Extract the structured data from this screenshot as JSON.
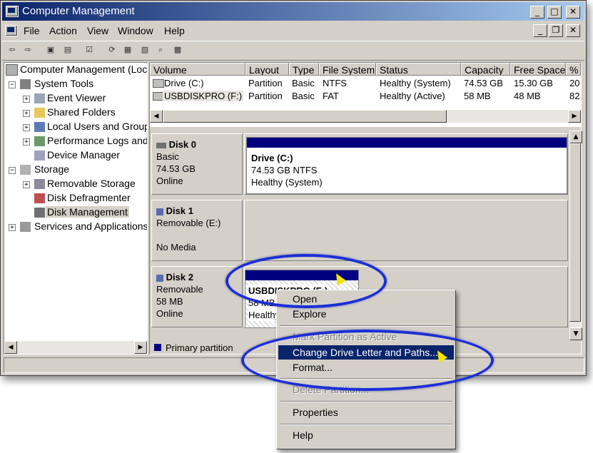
{
  "window": {
    "title": "Computer Management"
  },
  "menu": [
    "File",
    "Action",
    "View",
    "Window",
    "Help"
  ],
  "tree": {
    "root": "Computer Management (Loc",
    "system_tools": "System Tools",
    "event_viewer": "Event Viewer",
    "shared_folders": "Shared Folders",
    "local_users": "Local Users and Group",
    "perf_logs": "Performance Logs and",
    "device_manager": "Device Manager",
    "storage": "Storage",
    "removable_storage": "Removable Storage",
    "disk_defrag": "Disk Defragmenter",
    "disk_management": "Disk Management",
    "services": "Services and Applications"
  },
  "volume_list": {
    "columns": [
      "Volume",
      "Layout",
      "Type",
      "File System",
      "Status",
      "Capacity",
      "Free Space",
      "%"
    ],
    "rows": [
      [
        "Drive (C:)",
        "Partition",
        "Basic",
        "NTFS",
        "Healthy (System)",
        "74.53 GB",
        "15.30 GB",
        "20"
      ],
      [
        "USBDISKPRO (F:)",
        "Partition",
        "Basic",
        "FAT",
        "Healthy (Active)",
        "58 MB",
        "48 MB",
        "82"
      ]
    ]
  },
  "disks": {
    "disk0": {
      "name": "Disk 0",
      "type": "Basic",
      "size": "74.53 GB",
      "state": "Online",
      "partition": {
        "name": "Drive  (C:)",
        "size_fs": "74.53 GB NTFS",
        "status": "Healthy (System)"
      }
    },
    "disk1": {
      "name": "Disk 1",
      "type": "Removable (E:)",
      "state": "No Media"
    },
    "disk2": {
      "name": "Disk 2",
      "type": "Removable",
      "size": "58 MB",
      "state": "Online",
      "partition": {
        "name": "USBDISKPRO  (F:)",
        "size_fs": "58 MB",
        "status": "Healthy"
      }
    }
  },
  "legend": {
    "primary": "Primary partition"
  },
  "context_menu": {
    "open": "Open",
    "explore": "Explore",
    "mark_active": "Mark Partition as Active",
    "change_letter": "Change Drive Letter and Paths...",
    "format": "Format...",
    "delete": "Delete Partition...",
    "properties": "Properties",
    "help": "Help"
  },
  "colors": {
    "highlight": "#0a246a",
    "partition_bar": "#000080",
    "annotation": "#1a2fd6"
  }
}
